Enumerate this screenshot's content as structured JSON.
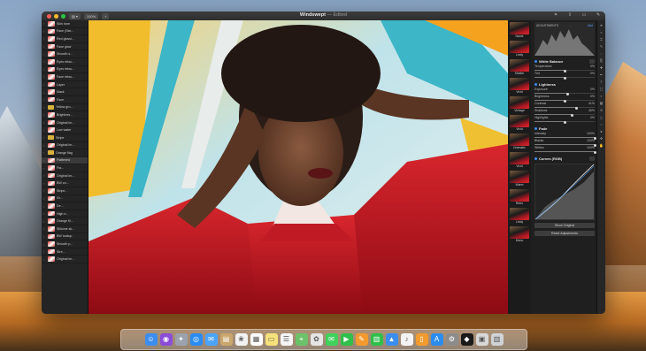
{
  "window": {
    "title": "Windswept",
    "subtitle": "— Edited",
    "zoom": "100%",
    "traffic_lights": [
      "#fe5f57",
      "#febc2e",
      "#28c840"
    ],
    "toolbar_icons": [
      "sidebar-icon",
      "plus-icon"
    ],
    "right_icons": [
      "crop-icon",
      "share-icon",
      "window-icon",
      "tools-icon"
    ]
  },
  "layers": [
    {
      "label": "Skin tone",
      "kind": "thumb"
    },
    {
      "label": "Face (Ske...",
      "kind": "thumb"
    },
    {
      "label": "Red glossi...",
      "kind": "thumb"
    },
    {
      "label": "Face glow",
      "kind": "thumb"
    },
    {
      "label": "Smooth s...",
      "kind": "thumb"
    },
    {
      "label": "Eyes retou...",
      "kind": "thumb"
    },
    {
      "label": "Eyes retou...",
      "kind": "thumb"
    },
    {
      "label": "Face retou...",
      "kind": "thumb"
    },
    {
      "label": "Layer",
      "kind": "thumb"
    },
    {
      "label": "Mask",
      "kind": "thumb"
    },
    {
      "label": "Face",
      "kind": "thumb"
    },
    {
      "label": "Yellow gro...",
      "kind": "folder"
    },
    {
      "label": "Brightnes...",
      "kind": "thumb"
    },
    {
      "label": "Original im...",
      "kind": "thumb"
    },
    {
      "label": "Low water",
      "kind": "thumb"
    },
    {
      "label": "Stripe",
      "kind": "folder"
    },
    {
      "label": "Original im...",
      "kind": "thumb"
    },
    {
      "label": "Orange flag",
      "kind": "folder"
    },
    {
      "label": "Flattened",
      "kind": "thumb"
    },
    {
      "label": "Fla...",
      "kind": "thumb"
    },
    {
      "label": "Original im...",
      "kind": "thumb"
    },
    {
      "label": "BW co...",
      "kind": "thumb"
    },
    {
      "label": "Stripe...",
      "kind": "thumb"
    },
    {
      "label": "Gr...",
      "kind": "thumb"
    },
    {
      "label": "De...",
      "kind": "thumb"
    },
    {
      "label": "High e...",
      "kind": "thumb"
    },
    {
      "label": "Orange fil...",
      "kind": "thumb"
    },
    {
      "label": "Silicone sk...",
      "kind": "thumb"
    },
    {
      "label": "BW lookup",
      "kind": "thumb"
    },
    {
      "label": "Smooth p...",
      "kind": "thumb"
    },
    {
      "label": "Stre...",
      "kind": "thumb"
    },
    {
      "label": "Original im...",
      "kind": "thumb"
    }
  ],
  "presets": [
    "Name",
    "Lindy",
    "Shelter",
    "Vivid",
    "Vintage",
    "Vivid",
    "Dramatic",
    "Vivid",
    "Warm",
    "Retro",
    "Lindy",
    "Mono"
  ],
  "adjustments": {
    "histogram_label": "ADJUSTMENTS",
    "histogram_right": "Add",
    "white_balance": {
      "title": "White Balance",
      "rows": [
        {
          "label": "Temperature",
          "value": "0%",
          "level": 0.5
        },
        {
          "label": "Tint",
          "value": "0%",
          "level": 0.5
        }
      ]
    },
    "lightness": {
      "title": "Lightness",
      "rows": [
        {
          "label": "Exposure",
          "value": "0%",
          "level": 0.55
        },
        {
          "label": "Brightness",
          "value": "0%",
          "level": 0.5
        },
        {
          "label": "Contrast",
          "value": "41%",
          "level": 0.7
        },
        {
          "label": "Shadows",
          "value": "46%",
          "level": 0.62
        },
        {
          "label": "Highlights",
          "value": "0%",
          "level": 0.5
        }
      ]
    },
    "fade": {
      "title": "Fade",
      "rows": [
        {
          "label": "Intensity",
          "value": "100%",
          "level": 1
        },
        {
          "label": "Blacks",
          "value": "100%",
          "level": 1
        },
        {
          "label": "Whites",
          "value": "100%",
          "level": 1
        }
      ]
    },
    "curves": {
      "title": "Curves (RGB)"
    },
    "buttons": {
      "show_original": "Show Original",
      "reset": "Reset Adjustments"
    }
  },
  "tools": [
    "cursor-icon",
    "zoom-icon",
    "crop-icon",
    "brush-icon",
    "eraser-icon",
    "clone-icon",
    "heal-icon",
    "pen-icon",
    "text-icon",
    "shape-icon",
    "gradient-icon",
    "fill-icon",
    "blur-icon",
    "sharpen-icon",
    "dodge-icon",
    "burn-icon",
    "color-picker-icon",
    "hand-icon"
  ],
  "dock": [
    {
      "name": "finder-icon",
      "color": "#3c8df0",
      "glyph": "☺"
    },
    {
      "name": "siri-icon",
      "color": "#8b4cd8",
      "glyph": "◉"
    },
    {
      "name": "launchpad-icon",
      "color": "#9aa3ad",
      "glyph": "✦"
    },
    {
      "name": "safari-icon",
      "color": "#2a8cf0",
      "glyph": "◎"
    },
    {
      "name": "mail-icon",
      "color": "#4aa3ff",
      "glyph": "✉"
    },
    {
      "name": "contacts-icon",
      "color": "#c9a66b",
      "glyph": "▤"
    },
    {
      "name": "photos-icon",
      "color": "#f2f2f2",
      "glyph": "❀"
    },
    {
      "name": "calendar-icon",
      "color": "#ffffff",
      "glyph": "▦"
    },
    {
      "name": "notes-icon",
      "color": "#f6e27a",
      "glyph": "▭"
    },
    {
      "name": "reminders-icon",
      "color": "#f4f4f4",
      "glyph": "☰"
    },
    {
      "name": "maps-icon",
      "color": "#6cc26a",
      "glyph": "⌖"
    },
    {
      "name": "photos-alt-icon",
      "color": "#e5e5e5",
      "glyph": "✿"
    },
    {
      "name": "messages-icon",
      "color": "#3fd25a",
      "glyph": "✉"
    },
    {
      "name": "facetime-icon",
      "color": "#2fbf4a",
      "glyph": "▶"
    },
    {
      "name": "pages-icon",
      "color": "#f39a2f",
      "glyph": "✎"
    },
    {
      "name": "numbers-icon",
      "color": "#2fbf4a",
      "glyph": "▥"
    },
    {
      "name": "keynote-icon",
      "color": "#3b8df2",
      "glyph": "▲"
    },
    {
      "name": "itunes-icon",
      "color": "#f3f3f3",
      "glyph": "♪"
    },
    {
      "name": "ibooks-icon",
      "color": "#f39a2f",
      "glyph": "▯"
    },
    {
      "name": "app-store-icon",
      "color": "#2a8cf0",
      "glyph": "A"
    },
    {
      "name": "system-preferences-icon",
      "color": "#8c8c8c",
      "glyph": "⚙"
    },
    {
      "name": "pixelmator-icon",
      "color": "#1a1a1a",
      "glyph": "◆"
    },
    {
      "name": "preview-icon",
      "color": "#d8d8d8",
      "glyph": "▣"
    },
    {
      "name": "trash-icon",
      "color": "#cfd3d6",
      "glyph": "▥"
    }
  ]
}
